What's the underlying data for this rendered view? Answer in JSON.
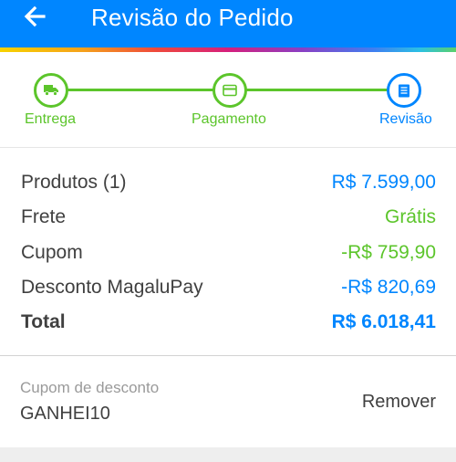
{
  "header": {
    "title": "Revisão do Pedido",
    "background_color": "#0086ff",
    "back_icon": "arrow-left-icon"
  },
  "stepper": {
    "steps": [
      {
        "label": "Entrega",
        "icon": "truck-icon",
        "state": "completed"
      },
      {
        "label": "Pagamento",
        "icon": "card-icon",
        "state": "completed"
      },
      {
        "label": "Revisão",
        "icon": "document-icon",
        "state": "current"
      }
    ],
    "completed_color": "#5cc52b",
    "current_color": "#0086ff"
  },
  "summary": {
    "products_label": "Produtos (1)",
    "products_value": "R$ 7.599,00",
    "shipping_label": "Frete",
    "shipping_value": "Grátis",
    "coupon_label": "Cupom",
    "coupon_value": "-R$ 759,90",
    "discount_label": "Desconto MagaluPay",
    "discount_value": "-R$ 820,69",
    "total_label": "Total",
    "total_value": "R$ 6.018,41"
  },
  "coupon": {
    "label": "Cupom de desconto",
    "code": "GANHEI10",
    "remove_label": "Remover"
  }
}
